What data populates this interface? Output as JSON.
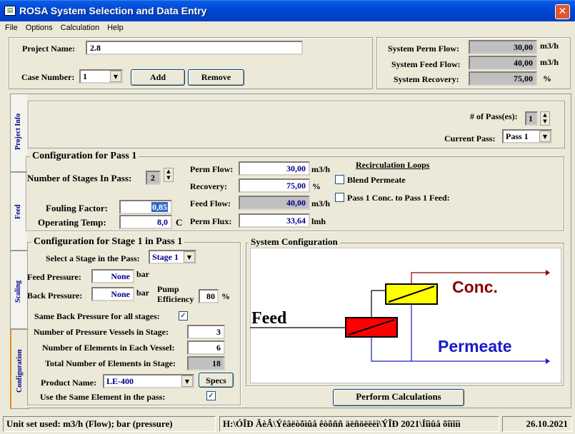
{
  "window": {
    "title": "ROSA System Selection and Data Entry",
    "close_glyph": "✕",
    "icon_glyph": "▤"
  },
  "menu": [
    "File",
    "Options",
    "Calculation",
    "Help"
  ],
  "project": {
    "name_label": "Project Name:",
    "name_value": "2.8",
    "case_label": "Case Number:",
    "case_value": "1",
    "add_label": "Add",
    "remove_label": "Remove"
  },
  "system": {
    "perm_flow_label": "System Perm Flow:",
    "perm_flow_value": "30,00",
    "perm_flow_unit": "m3/h",
    "feed_flow_label": "System Feed Flow:",
    "feed_flow_value": "40,00",
    "feed_flow_unit": "m3/h",
    "recovery_label": "System Recovery:",
    "recovery_value": "75,00",
    "recovery_unit": "%"
  },
  "tabs": [
    "Project Info",
    "Feed",
    "Scaling",
    "Configuration"
  ],
  "passes": {
    "num_label": "# of Pass(es):",
    "num_value": "1",
    "current_label": "Current Pass:",
    "current_value": "Pass 1"
  },
  "pass_config": {
    "title": "Configuration for Pass 1",
    "stages_label": "Number of Stages In Pass:",
    "stages_value": "2",
    "fouling_label": "Fouling Factor:",
    "fouling_value": "0,85",
    "temp_label": "Operating Temp:",
    "temp_value": "8,0",
    "temp_unit": "C",
    "perm_flow_label": "Perm Flow:",
    "perm_flow_value": "30,00",
    "perm_flow_unit": "m3/h",
    "recovery_label": "Recovery:",
    "recovery_value": "75,00",
    "recovery_unit": "%",
    "feed_flow_label": "Feed Flow:",
    "feed_flow_value": "40,00",
    "feed_flow_unit": "m3/h",
    "perm_flux_label": "Perm Flux:",
    "perm_flux_value": "33,64",
    "perm_flux_unit": "lmh",
    "recirc_title": "Recirculation Loops",
    "blend_label": "Blend Permeate",
    "conc_label": "Pass 1 Conc. to Pass 1 Feed:"
  },
  "stage_config": {
    "title": "Configuration for Stage 1 in Pass 1",
    "select_label": "Select a Stage in the Pass:",
    "select_value": "Stage 1",
    "feed_pressure_label": "Feed Pressure:",
    "feed_pressure_value": "None",
    "feed_pressure_unit": "bar",
    "back_pressure_label": "Back Pressure:",
    "back_pressure_value": "None",
    "back_pressure_unit": "bar",
    "pump_eff_label_1": "Pump",
    "pump_eff_label_2": "Efficiency",
    "pump_eff_value": "80",
    "pump_eff_unit": "%",
    "same_back_label": "Same Back Pressure for all stages:",
    "same_back_checked": "✓",
    "vessels_label": "Number of Pressure Vessels in Stage:",
    "vessels_value": "3",
    "elements_label": "Number of Elements in Each Vessel:",
    "elements_value": "6",
    "total_label": "Total Number of Elements in Stage:",
    "total_value": "18",
    "product_label": "Product Name:",
    "product_value": "LE-400",
    "specs_label": "Specs",
    "same_elem_label": "Use the Same Element in the pass:",
    "same_elem_checked": "✓"
  },
  "diagram": {
    "title": "System Configuration",
    "feed_label": "Feed",
    "conc_label": "Conc.",
    "permeate_label": "Permeate",
    "colors": {
      "stage1": "#ff0000",
      "stage2": "#ffff00",
      "conc": "#8b0000",
      "permeate": "#1a1acc"
    }
  },
  "perform_label": "Perform Calculations",
  "status": {
    "units": "Unit set used: m3/h (Flow); bar (pressure)",
    "path": "H:\\ÓÎÐ ÂèÂ\\Ýêâëòõìûå êòõññ äëñöëëèì\\ÝÎÐ 2021\\Íîìûå õîìîíì",
    "date": "26.10.2021"
  }
}
